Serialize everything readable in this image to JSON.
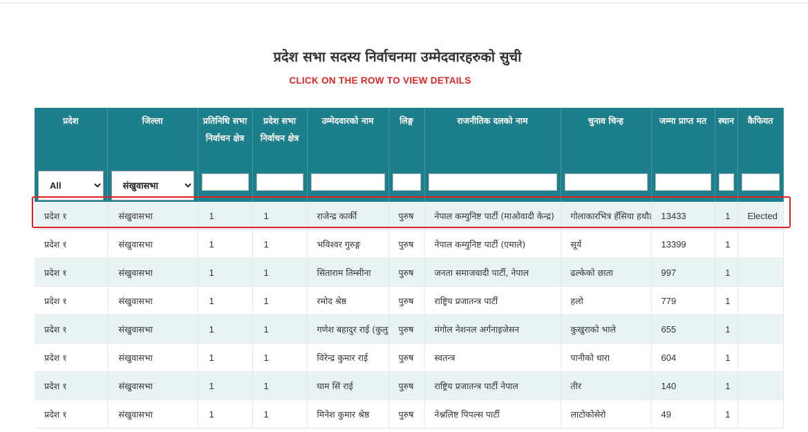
{
  "page": {
    "title": "प्रदेश सभा सदस्य निर्वाचनमा उम्मेदवारहरुको सुची",
    "subtitle": "CLICK ON THE ROW TO VIEW DETAILS"
  },
  "table": {
    "headers": [
      "प्रदेश",
      "जिल्ला",
      "प्रतिनिधि सभा निर्वाचन क्षेत्र",
      "प्रदेश सभा निर्वाचन क्षेत्र",
      "उम्मेदवारको नाम",
      "लिङ्ग",
      "राजनीतिक दलको नाम",
      "चुनाव चिन्ह",
      "जम्मा प्राप्त मत",
      "स्थान",
      "कैफियत"
    ],
    "filters": {
      "province_selected": "All",
      "district_selected": "संखुवासभा"
    },
    "rows": [
      {
        "province": "प्रदेश १",
        "district": "संखुवासभा",
        "hor": "1",
        "pa": "1",
        "name": "राजेन्द्र कार्की",
        "gender": "पुरुष",
        "party": "नेपाल कम्युनिष्ट पार्टी (माओवादी केन्द्र)",
        "symbol": "गोलाकारभित्र हँसिया हथौडा",
        "votes": "13433",
        "rank": "1",
        "remark": "Elected"
      },
      {
        "province": "प्रदेश १",
        "district": "संखुवासभा",
        "hor": "1",
        "pa": "1",
        "name": "भविश्वर गुरुङ्ग",
        "gender": "पुरुष",
        "party": "नेपाल कम्युनिष्ट पार्टी (एमाले)",
        "symbol": "सूर्य",
        "votes": "13399",
        "rank": "1",
        "remark": ""
      },
      {
        "province": "प्रदेश १",
        "district": "संखुवासभा",
        "hor": "1",
        "pa": "1",
        "name": "सिताराम तिम्सीना",
        "gender": "पुरुष",
        "party": "जनता समाजवादी पार्टी, नेपाल",
        "symbol": "ढल्केको छाता",
        "votes": "997",
        "rank": "1",
        "remark": ""
      },
      {
        "province": "प्रदेश १",
        "district": "संखुवासभा",
        "hor": "1",
        "pa": "1",
        "name": "रमोद श्रेष्ठ",
        "gender": "पुरुष",
        "party": "राष्ट्रिय प्रजातन्त्र पार्टी",
        "symbol": "हलो",
        "votes": "779",
        "rank": "1",
        "remark": ""
      },
      {
        "province": "प्रदेश १",
        "district": "संखुवासभा",
        "hor": "1",
        "pa": "1",
        "name": "गणेश बहादुर राई (कुलुङ)",
        "gender": "पुरुष",
        "party": "मंगोल नेशनल अर्गनाइजेसन",
        "symbol": "कुखुराको भाले",
        "votes": "655",
        "rank": "1",
        "remark": ""
      },
      {
        "province": "प्रदेश १",
        "district": "संखुवासभा",
        "hor": "1",
        "pa": "1",
        "name": "विरेन्द्र कुमार राई",
        "gender": "पुरुष",
        "party": "स्वतन्त्र",
        "symbol": "पानीको धारा",
        "votes": "604",
        "rank": "1",
        "remark": ""
      },
      {
        "province": "प्रदेश १",
        "district": "संखुवासभा",
        "hor": "1",
        "pa": "1",
        "name": "घाम सिं राई",
        "gender": "पुरुष",
        "party": "राष्ट्रिय प्रजातन्त्र पार्टी नेपाल",
        "symbol": "तीर",
        "votes": "140",
        "rank": "1",
        "remark": ""
      },
      {
        "province": "प्रदेश १",
        "district": "संखुवासभा",
        "hor": "1",
        "pa": "1",
        "name": "मिनेश कुमार श्रेष्ठ",
        "gender": "पुरुष",
        "party": "नेश्नलिष्ट पिपल्स पार्टी",
        "symbol": "लाटोकोसेरो",
        "votes": "49",
        "rank": "1",
        "remark": ""
      }
    ]
  },
  "colors": {
    "header_bg": "#1d7f8c",
    "subtitle": "#e32525",
    "highlight_border": "#e41e26",
    "row_alt": "#eaf3f4"
  }
}
